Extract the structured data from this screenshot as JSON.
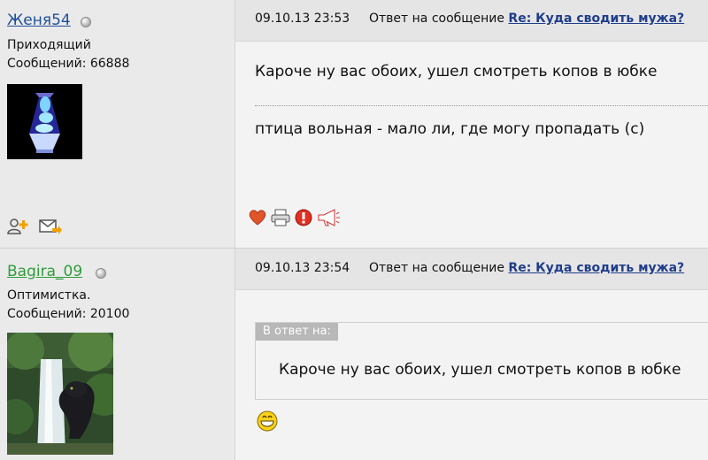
{
  "posts": [
    {
      "username": "Женя54",
      "username_color": "#1f4f9a",
      "rank": "Приходящий",
      "messages_label": "Сообщений: 66888",
      "timestamp": "09.10.13 23:53",
      "reply_prefix": "Ответ на сообщение",
      "subject": "Re: Куда сводить мужа?",
      "lines": [
        "Кароче ну вас обоих, ушел смотреть копов в юбке",
        "птица вольная - мало ли, где могу пропадать (с)"
      ],
      "avatar_icon": "lava-lamp-avatar",
      "action_icons": [
        "heart-icon",
        "printer-icon",
        "warning-icon",
        "megaphone-icon"
      ],
      "profile_icons": [
        "add-user-icon",
        "send-message-icon"
      ]
    },
    {
      "username": "Bagira_09",
      "username_color": "#2f9e3a",
      "rank": "Оптимистка.",
      "messages_label": "Сообщений: 20100",
      "timestamp": "09.10.13 23:54",
      "reply_prefix": "Ответ на сообщение",
      "subject": "Re: Куда сводить мужа?",
      "quote_label": "В ответ на:",
      "quote_text": "Кароче ну вас обоих, ушел смотреть копов в юбке",
      "avatar_icon": "panther-waterfall-avatar",
      "emoji_icon": "grinning-smiley-icon"
    }
  ]
}
